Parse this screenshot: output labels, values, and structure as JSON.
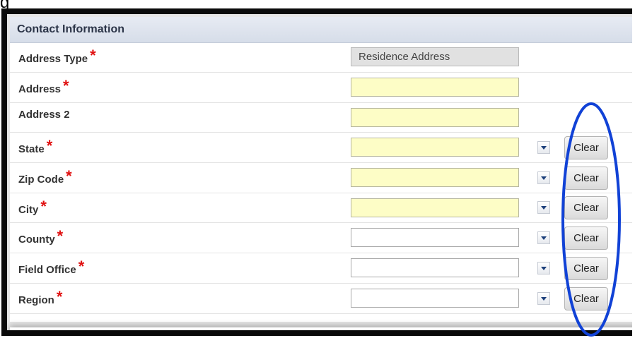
{
  "caption_fragment": "g",
  "section": {
    "title": "Contact Information"
  },
  "rows": [
    {
      "label": "Address Type",
      "required": true,
      "value": "Residence Address",
      "field_state": "readonly",
      "has_dropdown": false,
      "has_clear": false
    },
    {
      "label": "Address",
      "required": true,
      "value": "",
      "field_state": "required-empty",
      "has_dropdown": false,
      "has_clear": false
    },
    {
      "label": "Address 2",
      "required": false,
      "value": "",
      "field_state": "required-empty",
      "has_dropdown": false,
      "has_clear": false
    },
    {
      "label": "State",
      "required": true,
      "value": "",
      "field_state": "required-empty",
      "has_dropdown": true,
      "has_clear": true,
      "clear_label": "Clear"
    },
    {
      "label": "Zip Code",
      "required": true,
      "value": "",
      "field_state": "required-empty",
      "has_dropdown": true,
      "has_clear": true,
      "clear_label": "Clear"
    },
    {
      "label": "City",
      "required": true,
      "value": "",
      "field_state": "required-empty",
      "has_dropdown": true,
      "has_clear": true,
      "clear_label": "Clear"
    },
    {
      "label": "County",
      "required": true,
      "value": "",
      "field_state": "optional",
      "has_dropdown": true,
      "has_clear": true,
      "clear_label": "Clear"
    },
    {
      "label": "Field Office",
      "required": true,
      "value": "",
      "field_state": "optional",
      "has_dropdown": true,
      "has_clear": true,
      "clear_label": "Clear"
    },
    {
      "label": "Region",
      "required": true,
      "value": "",
      "field_state": "optional",
      "has_dropdown": true,
      "has_clear": true,
      "clear_label": "Clear"
    }
  ],
  "required_marker": "*",
  "icons": {
    "dropdown": "caret-down-icon",
    "annotation": "blue-ellipse-highlight"
  },
  "colors": {
    "header_bg": "#dde3ec",
    "required_star": "#e01010",
    "required_field_bg": "#fdfdc6",
    "readonly_field_bg": "#e1e1e1",
    "annotation_blue": "#1142d6",
    "frame": "#0a0a0a",
    "dropdown_caret": "#1c3f7a"
  }
}
